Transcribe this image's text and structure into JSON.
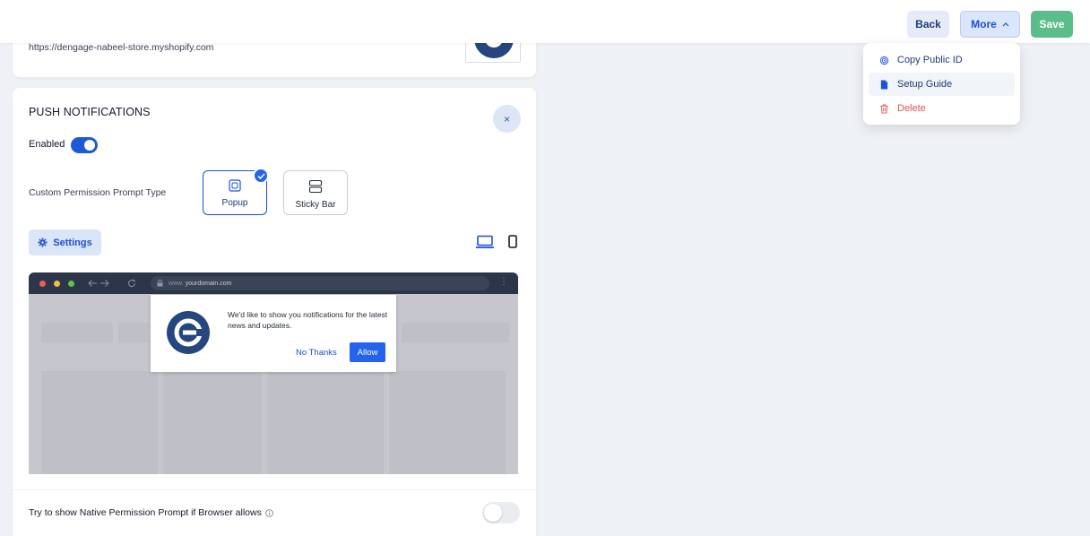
{
  "topbar": {
    "back_label": "Back",
    "more_label": "More",
    "save_label": "Save"
  },
  "more_menu": {
    "items": [
      {
        "label": "Copy Public ID",
        "icon": "fingerprint-icon"
      },
      {
        "label": "Setup Guide",
        "icon": "document-icon"
      },
      {
        "label": "Delete",
        "icon": "trash-icon"
      }
    ]
  },
  "store": {
    "url": "https://dengage-nabeel-store.myshopify.com"
  },
  "push": {
    "title": "PUSH NOTIFICATIONS",
    "close_glyph": "×",
    "enabled_label": "Enabled",
    "enabled": true,
    "prompt_type_label": "Custom Permission Prompt Type",
    "prompt_types": [
      {
        "label": "Popup",
        "selected": true
      },
      {
        "label": "Sticky Bar",
        "selected": false
      }
    ],
    "settings_label": "Settings"
  },
  "preview": {
    "address_prefix": "www.",
    "address": "yourdomain.com",
    "message": "We'd like to show you notifications for the latest news and updates.",
    "no_thanks": "No Thanks",
    "allow": "Allow"
  },
  "native": {
    "label": "Try to show Native Permission Prompt if Browser allows",
    "enabled": false
  },
  "colors": {
    "primary": "#1d4ed8",
    "save": "#5bbd8a",
    "danger": "#e05252",
    "brand": "#26467f"
  }
}
